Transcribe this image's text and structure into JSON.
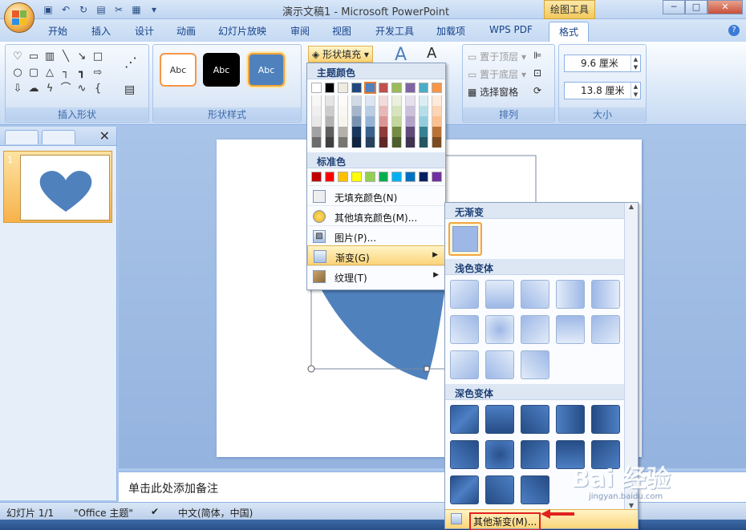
{
  "window": {
    "title": "演示文稿1 - Microsoft PowerPoint",
    "contextual_tab": "绘图工具",
    "min_label": "─",
    "max_label": "□",
    "close_label": "✕"
  },
  "tabs": [
    "开始",
    "插入",
    "设计",
    "动画",
    "幻灯片放映",
    "审阅",
    "视图",
    "开发工具",
    "加载项",
    "WPS PDF",
    "格式"
  ],
  "active_tab": "格式",
  "help_label": "?",
  "ribbon": {
    "groups": {
      "insert_shapes": "插入形状",
      "shape_styles": "形状样式",
      "arrange": "排列",
      "size": "大小"
    },
    "style_sample": "Abc",
    "shape_fill": "形状填充",
    "bring_front": "置于顶层",
    "send_back": "置于底层",
    "selection_pane": "选择窗格",
    "height": "9.6 厘米",
    "width": "13.8 厘米"
  },
  "slide_panel": {
    "thumb_number": "1",
    "close": "✕"
  },
  "notes_placeholder": "单击此处添加备注",
  "status": {
    "slide": "幻灯片 1/1",
    "theme": "\"Office 主题\"",
    "language": "中文(简体，中国)"
  },
  "fill_menu": {
    "theme_colors": "主题颜色",
    "standard_colors": "标准色",
    "no_fill": "无填充颜色(N)",
    "more_colors": "其他填充颜色(M)...",
    "picture": "图片(P)...",
    "gradient": "渐变(G)",
    "texture": "纹理(T)",
    "theme_row": [
      "#ffffff",
      "#000000",
      "#eeece1",
      "#1f497d",
      "#4f81bd",
      "#c0504d",
      "#9bbb59",
      "#8064a2",
      "#4bacc6",
      "#f79646"
    ],
    "standard_row": [
      "#c00000",
      "#ff0000",
      "#ffc000",
      "#ffff00",
      "#92d050",
      "#00b050",
      "#00b0f0",
      "#0070c0",
      "#002060",
      "#7030a0"
    ]
  },
  "gradient_menu": {
    "no_gradient": "无渐变",
    "light_variants": "浅色变体",
    "dark_variants": "深色变体",
    "more_gradients": "其他渐变(M)..."
  },
  "watermark": {
    "brand": "Bai 经验",
    "url": "jingyan.baidu.com"
  }
}
